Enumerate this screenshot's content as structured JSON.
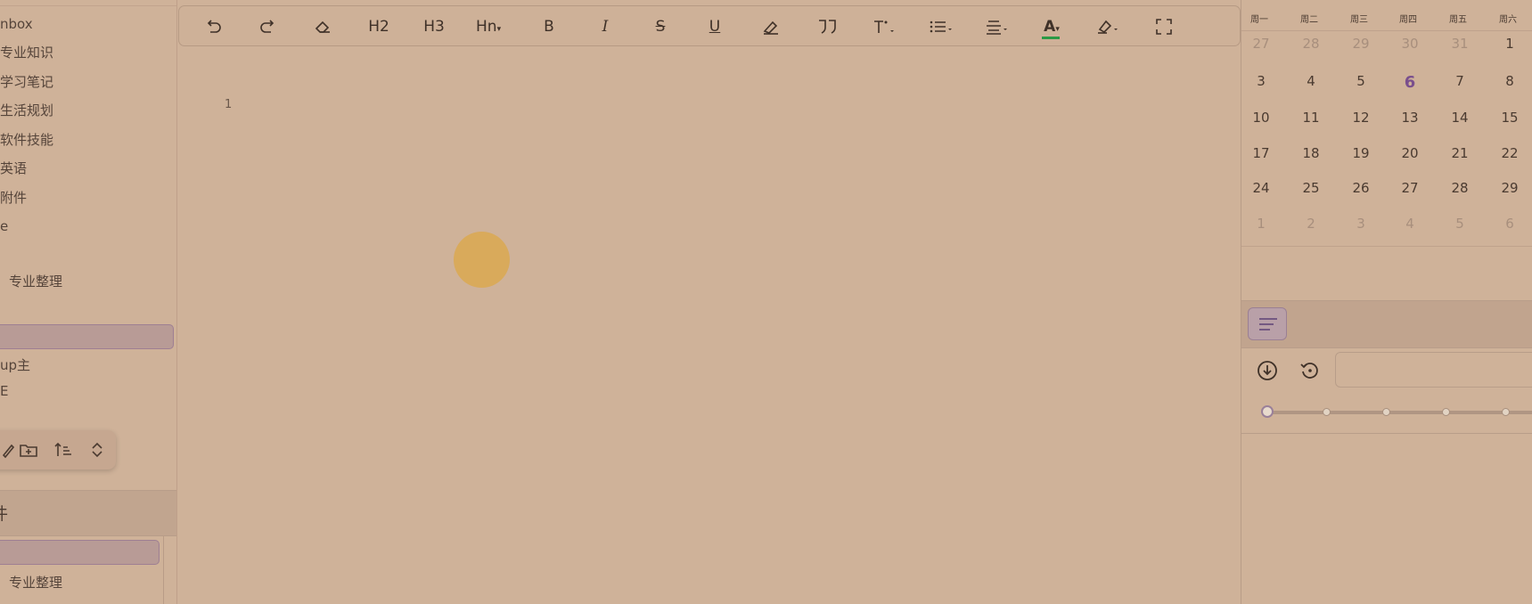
{
  "sidebar": {
    "tree": [
      {
        "label": "nbox"
      },
      {
        "label": "专业知识"
      },
      {
        "label": "学习笔记"
      },
      {
        "label": "生活规划"
      },
      {
        "label": "软件技能"
      },
      {
        "label": "英语"
      },
      {
        "label": "附件"
      },
      {
        "label": "e"
      },
      {
        "label": ""
      },
      {
        "label": "专业整理"
      },
      {
        "label": ""
      },
      {
        "label": ""
      },
      {
        "label": "up主"
      },
      {
        "label": "E"
      }
    ],
    "section_title": "件",
    "lower_list": [
      {
        "label": ""
      },
      {
        "label": "专业整理"
      }
    ]
  },
  "editor": {
    "line_number": "1",
    "toolbar": {
      "h2": "H2",
      "h3": "H3",
      "hn": "Hn",
      "bold": "B",
      "italic": "I",
      "strike": "S",
      "underline": "U",
      "font_color": "A",
      "font_color_bar": "#2a9a45"
    }
  },
  "calendar": {
    "weekdays": [
      "周一",
      "周二",
      "周三",
      "周四",
      "周五",
      "周六"
    ],
    "weeks": [
      [
        "27",
        "28",
        "29",
        "30",
        "31",
        "1"
      ],
      [
        "3",
        "4",
        "5",
        "6",
        "7",
        "8"
      ],
      [
        "10",
        "11",
        "12",
        "13",
        "14",
        "15"
      ],
      [
        "17",
        "18",
        "19",
        "20",
        "21",
        "22"
      ],
      [
        "24",
        "25",
        "26",
        "27",
        "28",
        "29"
      ],
      [
        "1",
        "2",
        "3",
        "4",
        "5",
        "6"
      ]
    ],
    "today": "6"
  },
  "colors": {
    "background": "#cfb299",
    "selection": "#b89b96",
    "accent": "#7a4f8d",
    "cursor": "#dba850"
  }
}
